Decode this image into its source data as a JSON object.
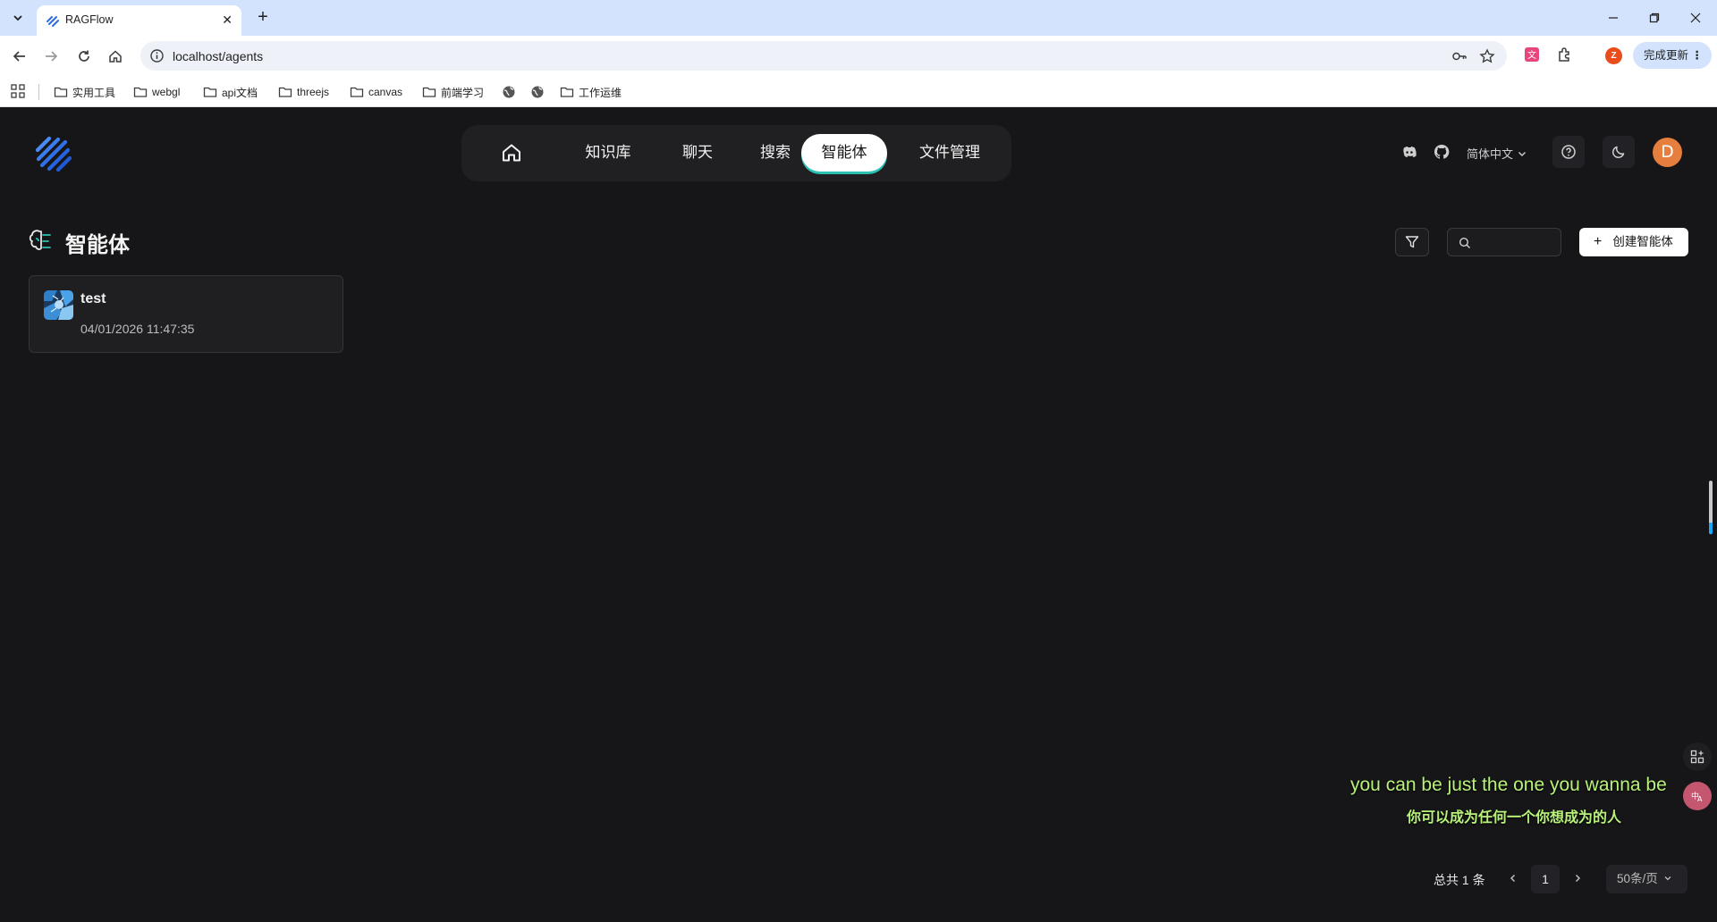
{
  "browser": {
    "tab_title": "RAGFlow",
    "url": "localhost/agents",
    "update_label": "完成更新",
    "ext_badge": "Z",
    "bookmarks": [
      "实用工具",
      "webgl",
      "api文档",
      "threejs",
      "canvas",
      "前端学习",
      "工作运维"
    ]
  },
  "nav": {
    "items": [
      "知识库",
      "聊天",
      "搜索",
      "智能体",
      "文件管理"
    ],
    "active": "智能体"
  },
  "header": {
    "language": "简体中文",
    "avatar_letter": "D"
  },
  "page": {
    "title": "智能体",
    "search_placeholder": "",
    "create_label": "创建智能体"
  },
  "agents": [
    {
      "name": "test",
      "date": "04/01/2026 11:47:35"
    }
  ],
  "subtitle": {
    "en": "you can be just the one you wanna be",
    "zh": "你可以成为任何一个你想成为的人"
  },
  "pagination": {
    "total_label": "总共 1 条",
    "current_page": "1",
    "page_size": "50条/页"
  },
  "colors": {
    "background": "#161618",
    "active_tab_underline": "#2bc2b3",
    "accent_blue": "#1ea7f7",
    "subtitle": "#b9f27a"
  }
}
